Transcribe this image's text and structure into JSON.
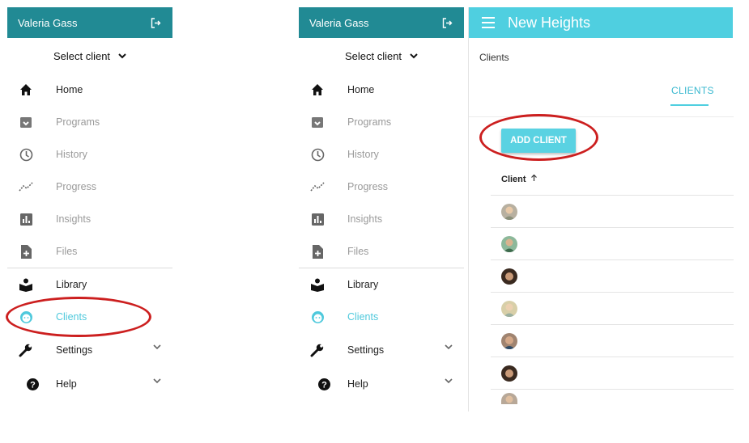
{
  "user": {
    "name": "Valeria Gass"
  },
  "select_client": {
    "label": "Select client"
  },
  "nav": [
    {
      "label": "Home",
      "icon": "home-icon"
    },
    {
      "label": "Programs",
      "icon": "programs-icon"
    },
    {
      "label": "History",
      "icon": "history-icon"
    },
    {
      "label": "Progress",
      "icon": "progress-icon"
    },
    {
      "label": "Insights",
      "icon": "insights-icon"
    },
    {
      "label": "Files",
      "icon": "files-icon"
    },
    {
      "label": "Library",
      "icon": "library-icon"
    },
    {
      "label": "Clients",
      "icon": "clients-icon"
    },
    {
      "label": "Settings",
      "icon": "settings-icon"
    },
    {
      "label": "Help",
      "icon": "help-icon"
    }
  ],
  "app": {
    "title": "New Heights",
    "breadcrumb": "Clients"
  },
  "tabs": [
    {
      "label": "CLIENTS"
    }
  ],
  "actions": {
    "add_client": "ADD CLIENT"
  },
  "table": {
    "column": "Client",
    "row_count": 7
  },
  "colors": {
    "header": "#218a94",
    "topbar": "#4fcfe0",
    "accent": "#4fc9dc",
    "highlight": "#cc1f1f"
  }
}
